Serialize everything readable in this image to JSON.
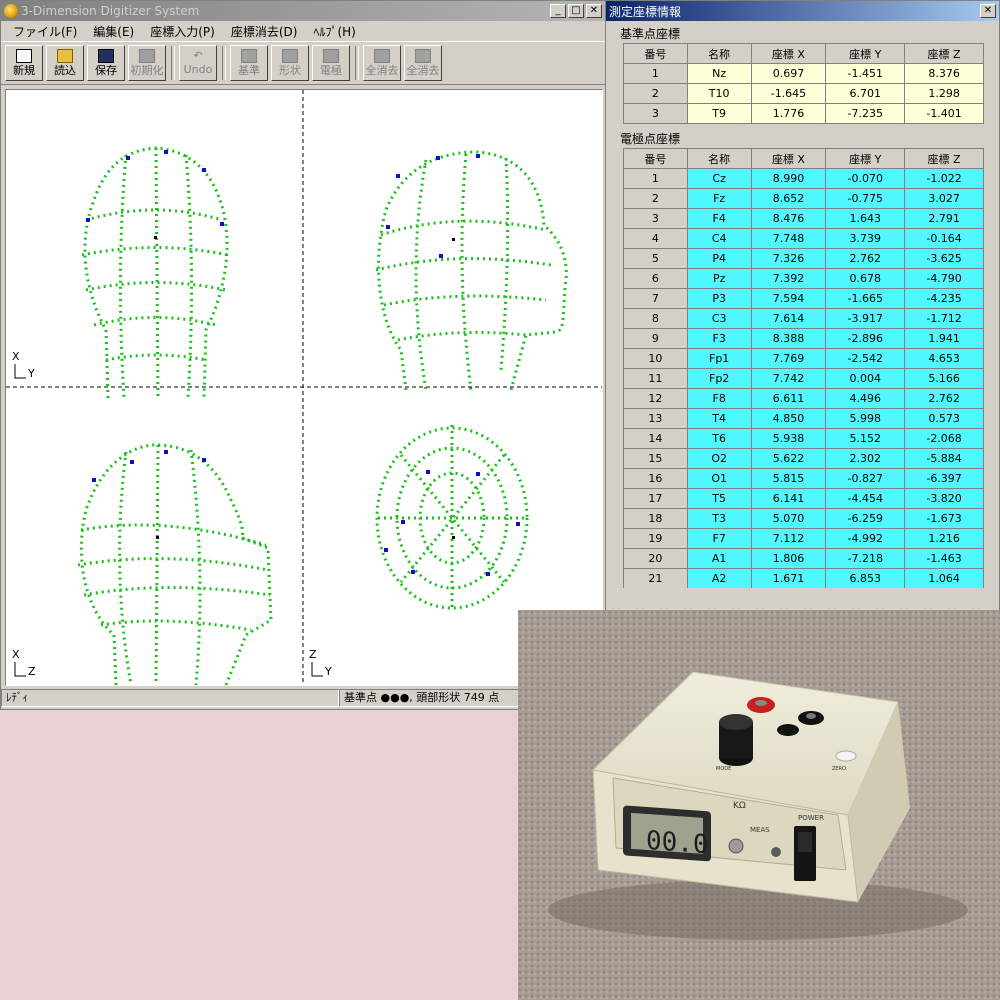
{
  "main_window": {
    "title": "3-Dimension Digitizer System",
    "menu": [
      "ファイル(F)",
      "編集(E)",
      "座標入力(P)",
      "座標消去(D)",
      "ﾍﾙﾌﾟ(H)"
    ],
    "toolbar": [
      {
        "label": "新規",
        "icon": "new-file-icon",
        "enabled": true
      },
      {
        "label": "読込",
        "icon": "open-folder-icon",
        "enabled": true
      },
      {
        "label": "保存",
        "icon": "save-disk-icon",
        "enabled": true
      },
      {
        "label": "初期化",
        "icon": "reset-icon",
        "enabled": false
      },
      {
        "label": "Undo",
        "icon": "undo-icon",
        "enabled": false
      },
      {
        "label": "基準",
        "icon": "reference-icon",
        "enabled": false
      },
      {
        "label": "形状",
        "icon": "shape-icon",
        "enabled": false
      },
      {
        "label": "電極",
        "icon": "electrode-icon",
        "enabled": false
      },
      {
        "label": "全消去",
        "icon": "clear-all-icon",
        "enabled": false
      },
      {
        "label": "全消去",
        "icon": "clear-all-icon",
        "enabled": false
      }
    ],
    "axis_labels": {
      "top_left": {
        "up": "X",
        "right": "Y"
      },
      "bottom_left": {
        "up": "X",
        "right": "Z"
      },
      "bottom_right": {
        "up": "Z",
        "right": "Y"
      }
    },
    "status_left": "ﾚﾃﾞｨ",
    "status_right": "基準点 ●●●, 頭部形状 749 点"
  },
  "coord_window": {
    "title": "測定座標情報",
    "reference_title": "基準点座標",
    "electrode_title": "電極点座標",
    "headers": [
      "番号",
      "名称",
      "座標 X",
      "座標 Y",
      "座標 Z"
    ],
    "reference_rows": [
      [
        "1",
        "Nz",
        "0.697",
        "-1.451",
        "8.376"
      ],
      [
        "2",
        "T10",
        "-1.645",
        "6.701",
        "1.298"
      ],
      [
        "3",
        "T9",
        "1.776",
        "-7.235",
        "-1.401"
      ]
    ],
    "electrode_rows": [
      [
        "1",
        "Cz",
        "8.990",
        "-0.070",
        "-1.022"
      ],
      [
        "2",
        "Fz",
        "8.652",
        "-0.775",
        "3.027"
      ],
      [
        "3",
        "F4",
        "8.476",
        "1.643",
        "2.791"
      ],
      [
        "4",
        "C4",
        "7.748",
        "3.739",
        "-0.164"
      ],
      [
        "5",
        "P4",
        "7.326",
        "2.762",
        "-3.625"
      ],
      [
        "6",
        "Pz",
        "7.392",
        "0.678",
        "-4.790"
      ],
      [
        "7",
        "P3",
        "7.594",
        "-1.665",
        "-4.235"
      ],
      [
        "8",
        "C3",
        "7.614",
        "-3.917",
        "-1.712"
      ],
      [
        "9",
        "F3",
        "8.388",
        "-2.896",
        "1.941"
      ],
      [
        "10",
        "Fp1",
        "7.769",
        "-2.542",
        "4.653"
      ],
      [
        "11",
        "Fp2",
        "7.742",
        "0.004",
        "5.166"
      ],
      [
        "12",
        "F8",
        "6.611",
        "4.496",
        "2.762"
      ],
      [
        "13",
        "T4",
        "4.850",
        "5.998",
        "0.573"
      ],
      [
        "14",
        "T6",
        "5.938",
        "5.152",
        "-2.068"
      ],
      [
        "15",
        "O2",
        "5.622",
        "2.302",
        "-5.884"
      ],
      [
        "16",
        "O1",
        "5.815",
        "-0.827",
        "-6.397"
      ],
      [
        "17",
        "T5",
        "6.141",
        "-4.454",
        "-3.820"
      ],
      [
        "18",
        "T3",
        "5.070",
        "-6.259",
        "-1.673"
      ],
      [
        "19",
        "F7",
        "7.112",
        "-4.992",
        "1.216"
      ],
      [
        "20",
        "A1",
        "1.806",
        "-7.218",
        "-1.463"
      ],
      [
        "21",
        "A2",
        "1.671",
        "6.853",
        "1.064"
      ]
    ]
  },
  "device_photo": {
    "unit_label": "KΩ",
    "display": "00.0",
    "meas_label": "MEAS",
    "power_label": "POWER",
    "mode_label": "MODE",
    "zero_label": "ZERO"
  },
  "colors": {
    "plot_points": "#18c018",
    "electrode_points": "#1010c0",
    "reference_cells": "#ffffd8",
    "electrode_cells": "#4ff8ff",
    "desktop": "#ead2d4"
  }
}
